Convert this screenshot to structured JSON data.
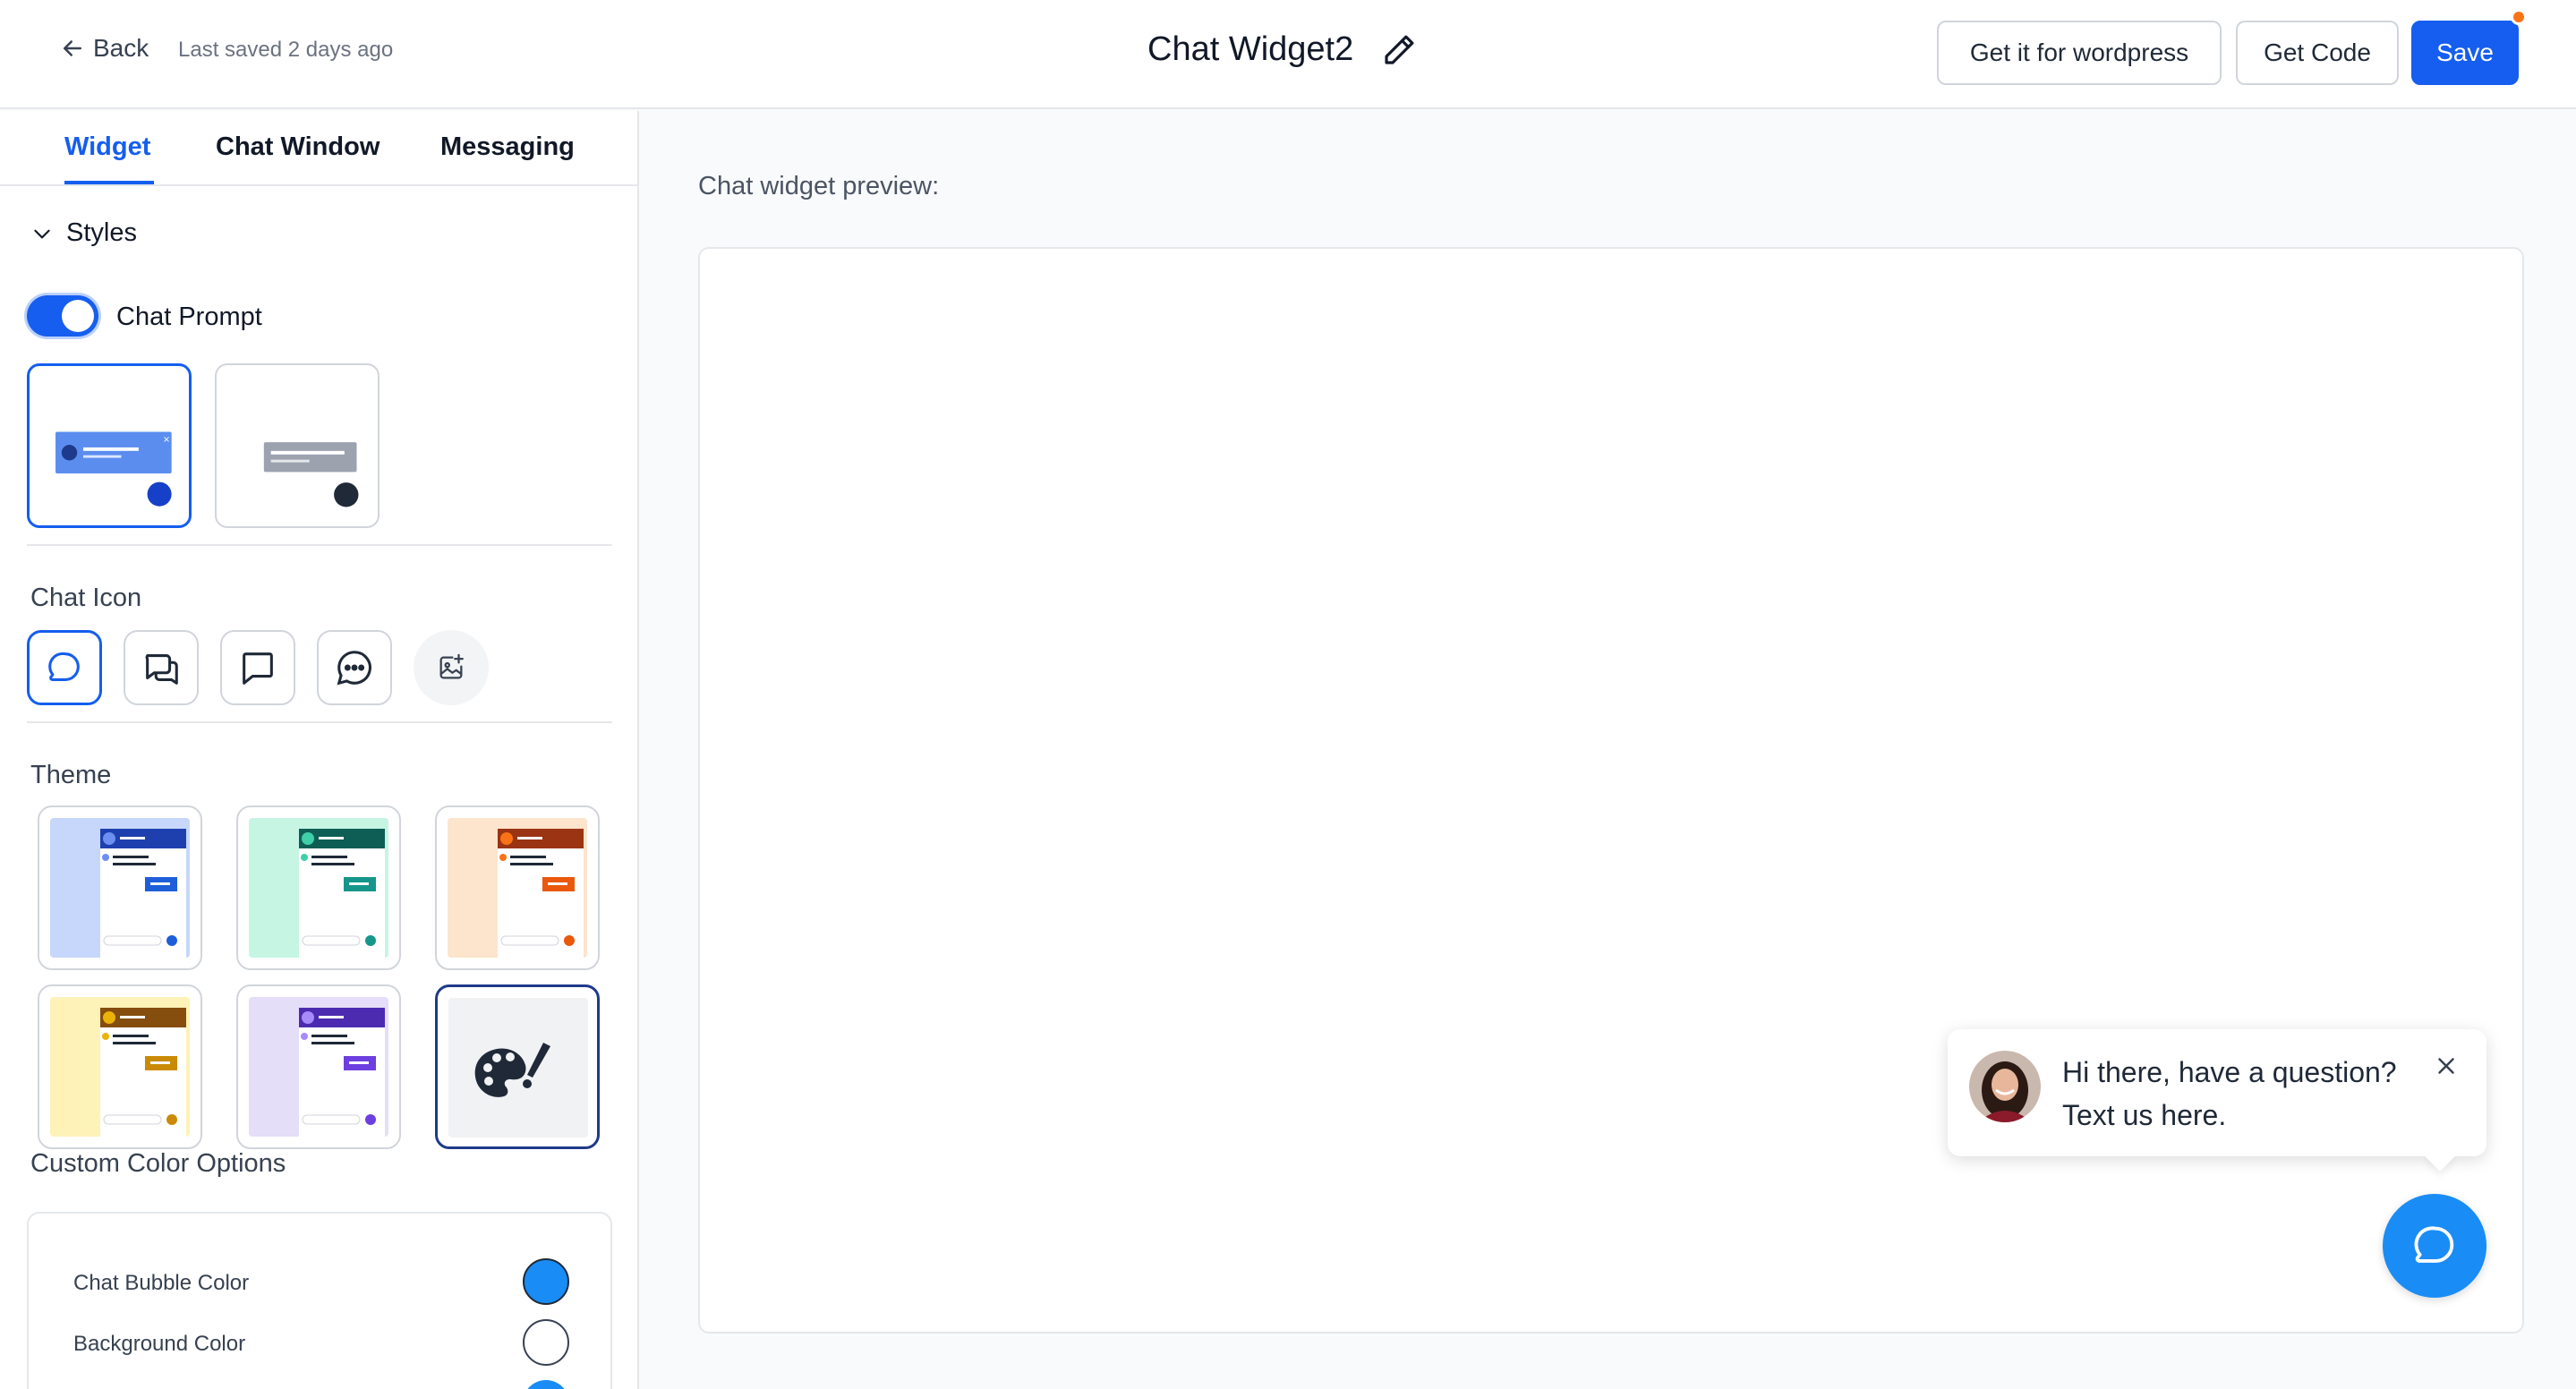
{
  "header": {
    "back_label": "Back",
    "last_saved": "Last saved 2 days ago",
    "title": "Chat Widget2",
    "btn_wordpress": "Get it for wordpress",
    "btn_code": "Get Code",
    "btn_save": "Save"
  },
  "tabs": [
    {
      "label": "Widget",
      "active": true
    },
    {
      "label": "Chat Window",
      "active": false
    },
    {
      "label": "Messaging",
      "active": false
    }
  ],
  "styles": {
    "section_label": "Styles",
    "chat_prompt_label": "Chat Prompt",
    "chat_prompt_enabled": true
  },
  "chat_icon": {
    "label": "Chat Icon",
    "options": [
      "chat-bubble-icon",
      "double-chat-bubble-icon",
      "square-chat-bubble-icon",
      "chat-dots-icon",
      "upload-image-icon"
    ],
    "selected": "chat-bubble-icon"
  },
  "theme": {
    "label": "Theme",
    "options": [
      {
        "name": "blue",
        "primary": "#1e40af",
        "bg": "#c7d7fb"
      },
      {
        "name": "green",
        "primary": "#0f5e55",
        "bg": "#c6f5e4"
      },
      {
        "name": "orange",
        "primary": "#9a3412",
        "bg": "#fde4cc"
      },
      {
        "name": "yellow",
        "primary": "#854d0e",
        "bg": "#fdf2b8"
      },
      {
        "name": "purple",
        "primary": "#4c2bb0",
        "bg": "#e4def9"
      },
      {
        "name": "custom",
        "primary": "#1f2937",
        "bg": "#f1f2f4"
      }
    ],
    "selected": "custom"
  },
  "custom_colors": {
    "label": "Custom Color Options",
    "rows": [
      {
        "label": "Chat Bubble Color",
        "color": "#1a8cf6"
      },
      {
        "label": "Background Color",
        "color": "#ffffff"
      }
    ]
  },
  "preview": {
    "label": "Chat widget preview:",
    "prompt_line1": "Hi there, have a question?",
    "prompt_line2": "Text us here."
  },
  "colors": {
    "accent": "#155eef",
    "launcher": "#1a8cf6",
    "notification_dot": "#f97316"
  }
}
